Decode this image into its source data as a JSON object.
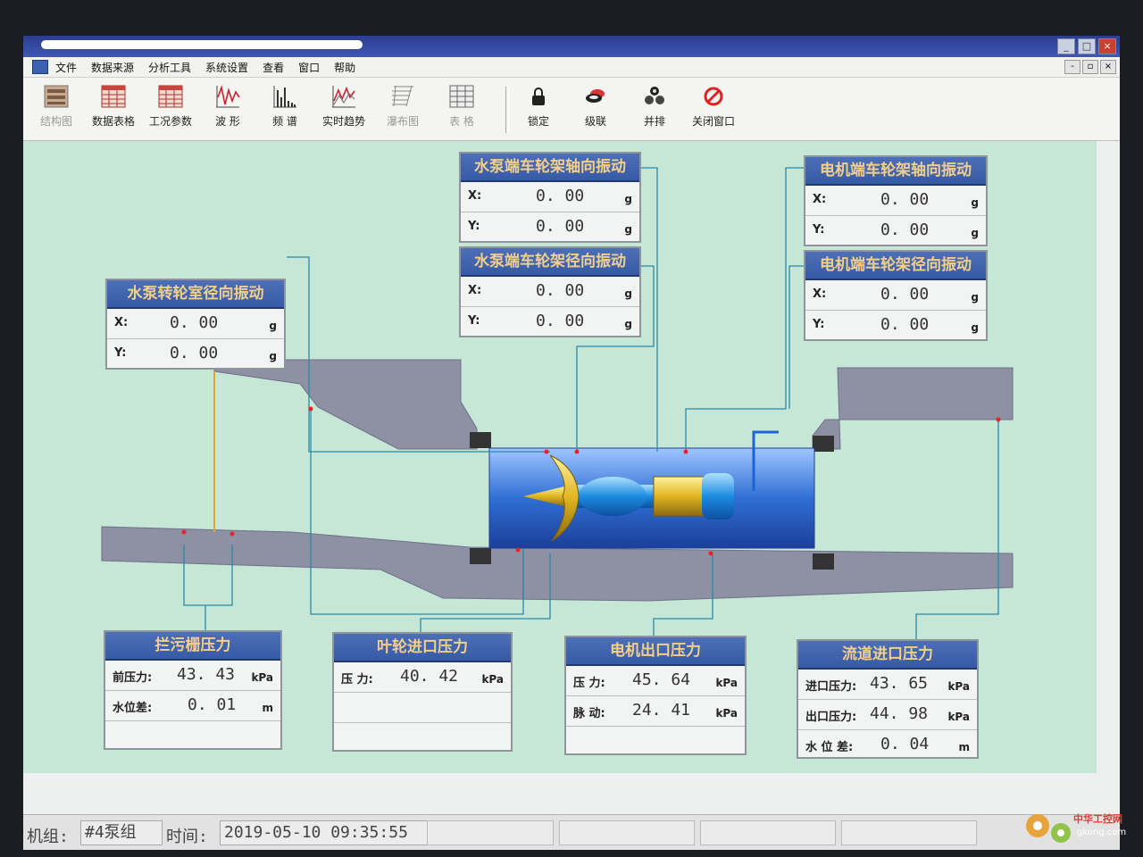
{
  "menu": [
    "文件",
    "数据来源",
    "分析工具",
    "系统设置",
    "查看",
    "窗口",
    "帮助"
  ],
  "toolbar": {
    "left": [
      "结构图",
      "数据表格",
      "工况参数",
      "波 形",
      "频 谱",
      "实时趋势",
      "瀑布图",
      "表 格"
    ],
    "right": [
      "锁定",
      "级联",
      "并排",
      "关闭窗口"
    ]
  },
  "panels": {
    "pump_wheel_room_radial": {
      "title": "水泵转轮室径向振动",
      "rows": [
        {
          "k": "X:",
          "v": "0. 00",
          "u": "g"
        },
        {
          "k": "Y:",
          "v": "0. 00",
          "u": "g"
        }
      ]
    },
    "pump_end_frame_axial": {
      "title": "水泵端车轮架轴向振动",
      "rows": [
        {
          "k": "X:",
          "v": "0. 00",
          "u": "g"
        },
        {
          "k": "Y:",
          "v": "0. 00",
          "u": "g"
        }
      ]
    },
    "pump_end_frame_radial": {
      "title": "水泵端车轮架径向振动",
      "rows": [
        {
          "k": "X:",
          "v": "0. 00",
          "u": "g"
        },
        {
          "k": "Y:",
          "v": "0. 00",
          "u": "g"
        }
      ]
    },
    "motor_end_frame_axial": {
      "title": "电机端车轮架轴向振动",
      "rows": [
        {
          "k": "X:",
          "v": "0. 00",
          "u": "g"
        },
        {
          "k": "Y:",
          "v": "0. 00",
          "u": "g"
        }
      ]
    },
    "motor_end_frame_radial": {
      "title": "电机端车轮架径向振动",
      "rows": [
        {
          "k": "X:",
          "v": "0. 00",
          "u": "g"
        },
        {
          "k": "Y:",
          "v": "0. 00",
          "u": "g"
        }
      ]
    },
    "trash_rack_pressure": {
      "title": "拦污栅压力",
      "rows": [
        {
          "k": "前压力:",
          "v": "43. 43",
          "u": "kPa"
        },
        {
          "k": "水位差:",
          "v": "0. 01",
          "u": "m"
        },
        {
          "k": "",
          "v": "",
          "u": ""
        }
      ]
    },
    "impeller_inlet_pressure": {
      "title": "叶轮进口压力",
      "rows": [
        {
          "k": "压 力:",
          "v": "40. 42",
          "u": "kPa"
        },
        {
          "k": "",
          "v": "",
          "u": ""
        },
        {
          "k": "",
          "v": "",
          "u": ""
        }
      ]
    },
    "motor_outlet_pressure": {
      "title": "电机出口压力",
      "rows": [
        {
          "k": "压 力:",
          "v": "45. 64",
          "u": "kPa"
        },
        {
          "k": "脉 动:",
          "v": "24. 41",
          "u": "kPa"
        },
        {
          "k": "",
          "v": "",
          "u": ""
        }
      ]
    },
    "channel_inlet_pressure": {
      "title": "流道进口压力",
      "rows": [
        {
          "k": "进口压力:",
          "v": "43. 65",
          "u": "kPa"
        },
        {
          "k": "出口压力:",
          "v": "44. 98",
          "u": "kPa"
        },
        {
          "k": "水 位 差:",
          "v": "0. 04",
          "u": "m"
        }
      ]
    }
  },
  "status": {
    "unit_label": "机组:",
    "unit_value": "#4泵组",
    "time_label": "时间:",
    "time_value": "2019-05-10 09:35:55"
  },
  "watermark": {
    "line1": "中华工控网",
    "line2": "gkong.com"
  },
  "colors": {
    "panel_title_bg": "#3d61ab",
    "panel_title_text": "#f3cf8a",
    "canvas_bg": "#c6e6d6",
    "pipe": "#2f6fd4",
    "concrete": "#8e90a4"
  }
}
